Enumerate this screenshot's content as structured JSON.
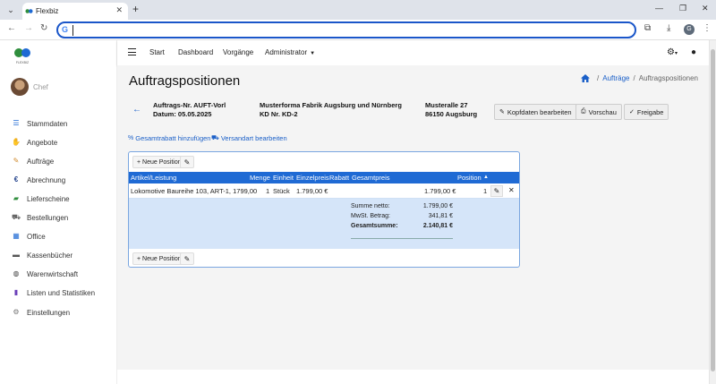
{
  "browser": {
    "tab_title": "Flexbiz",
    "address_value": "",
    "profile_letter": "G"
  },
  "sidebar": {
    "logo_text": "FLEXBIZ",
    "user_name": "Chef",
    "items": [
      {
        "label": "Stammdaten",
        "icon": "list-icon"
      },
      {
        "label": "Angebote",
        "icon": "handshake-icon"
      },
      {
        "label": "Aufträge",
        "icon": "orders-icon"
      },
      {
        "label": "Abrechnung",
        "icon": "euro-icon"
      },
      {
        "label": "Lieferscheine",
        "icon": "truck-icon"
      },
      {
        "label": "Bestellungen",
        "icon": "cart-icon"
      },
      {
        "label": "Office",
        "icon": "office-icon"
      },
      {
        "label": "Kassenbücher",
        "icon": "cashbox-icon"
      },
      {
        "label": "Warenwirtschaft",
        "icon": "warehouse-icon"
      },
      {
        "label": "Listen und Statistiken",
        "icon": "chart-icon"
      },
      {
        "label": "Einstellungen",
        "icon": "settings-icon"
      }
    ]
  },
  "topnav": {
    "links": [
      "Start",
      "Dashboard",
      "Vorgänge",
      "Administrator"
    ]
  },
  "page": {
    "title": "Auftragspositionen",
    "breadcrumb": {
      "link": "Aufträge",
      "current": "Auftragspositionen"
    }
  },
  "order": {
    "number_label": "Auftrags-Nr.  AUFT-Vorl",
    "date_label": "Datum: 05.05.2025",
    "customer_name": "Musterforma Fabrik Augsburg und Nürnberg",
    "customer_number": "KD Nr. KD-2",
    "street": "Musteralle 27",
    "city": "86150 Augsburg"
  },
  "buttons": {
    "edit_header": "Kopfdaten bearbeiten",
    "preview": "Vorschau",
    "release": "Freigabe"
  },
  "actions": {
    "total_discount": "Gesamtrabatt hinzufügen",
    "shipping": "Versandart bearbeiten"
  },
  "table": {
    "new_position": "+ Neue Position",
    "headers": {
      "article": "Artikel/Leistung",
      "quantity": "Menge",
      "unit": "Einheit",
      "unit_price": "Einzelpreis",
      "discount": "Rabatt",
      "total": "Gesamtpreis",
      "position": "Position"
    },
    "rows": [
      {
        "article": "Lokomotive Baureihe 103, ART-1, 1799,00",
        "quantity": "1",
        "unit": "Stück",
        "unit_price": "1.799,00 €",
        "discount": "",
        "total": "1.799,00 €",
        "position": "1"
      }
    ],
    "totals": {
      "net_label": "Summe netto:",
      "net_value": "1.799,00 €",
      "vat_label": "MwSt. Betrag:",
      "vat_value": "341,81 €",
      "gross_label": "Gesamtsumme:",
      "gross_value": "2.140,81 €"
    }
  },
  "colors": {
    "accent": "#1f6ad4",
    "totals_bg": "#d5e5f9",
    "main_bg": "#f4f4f4"
  }
}
